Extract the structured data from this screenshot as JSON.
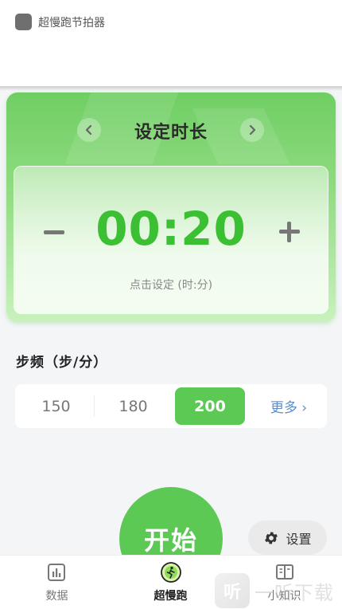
{
  "app": {
    "title": "超慢跑节拍器"
  },
  "timer": {
    "title": "设定时长",
    "value": "00:20",
    "hint": "点击设定 (时:分)",
    "prev_icon": "chevron-left-icon",
    "next_icon": "chevron-right-icon"
  },
  "cadence": {
    "label": "步频（步/分）",
    "options": [
      "150",
      "180",
      "200"
    ],
    "selected": "200",
    "more_label": "更多 ›"
  },
  "start": {
    "label": "开始"
  },
  "settings": {
    "label": "设置",
    "icon": "gear-icon"
  },
  "tabs": [
    {
      "label": "数据",
      "icon": "bar-chart-icon",
      "active": false
    },
    {
      "label": "超慢跑",
      "icon": "runner-icon",
      "active": true
    },
    {
      "label": "小知识",
      "icon": "book-icon",
      "active": false
    }
  ],
  "watermark": {
    "text": "一听下载",
    "logo_text": "听"
  },
  "colors": {
    "accent": "#5cc954",
    "time": "#3bbf33",
    "link": "#5b8dcc"
  }
}
